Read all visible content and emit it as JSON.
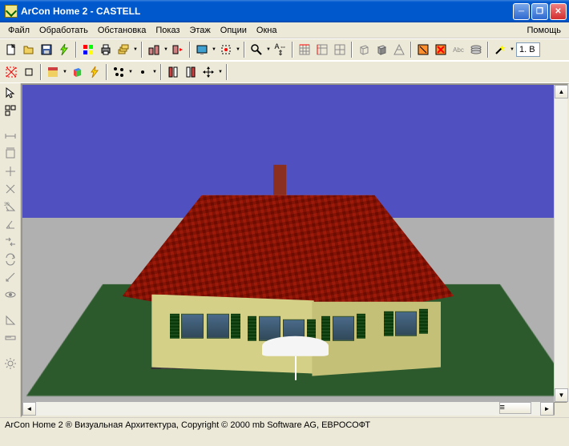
{
  "window": {
    "title": "ArCon  Home 2 - CASTELL"
  },
  "menu": {
    "file": "Файл",
    "edit": "Обработать",
    "setup": "Обстановка",
    "view": "Показ",
    "floor": "Этаж",
    "options": "Опции",
    "windows": "Окна",
    "help": "Помощь"
  },
  "toolbar": {
    "floor_input": "1. В"
  },
  "status": {
    "text": "ArCon Home 2 ® Визуальная Архитектура, Copyright © 2000 mb Software AG, ЕВРОСОФТ"
  }
}
